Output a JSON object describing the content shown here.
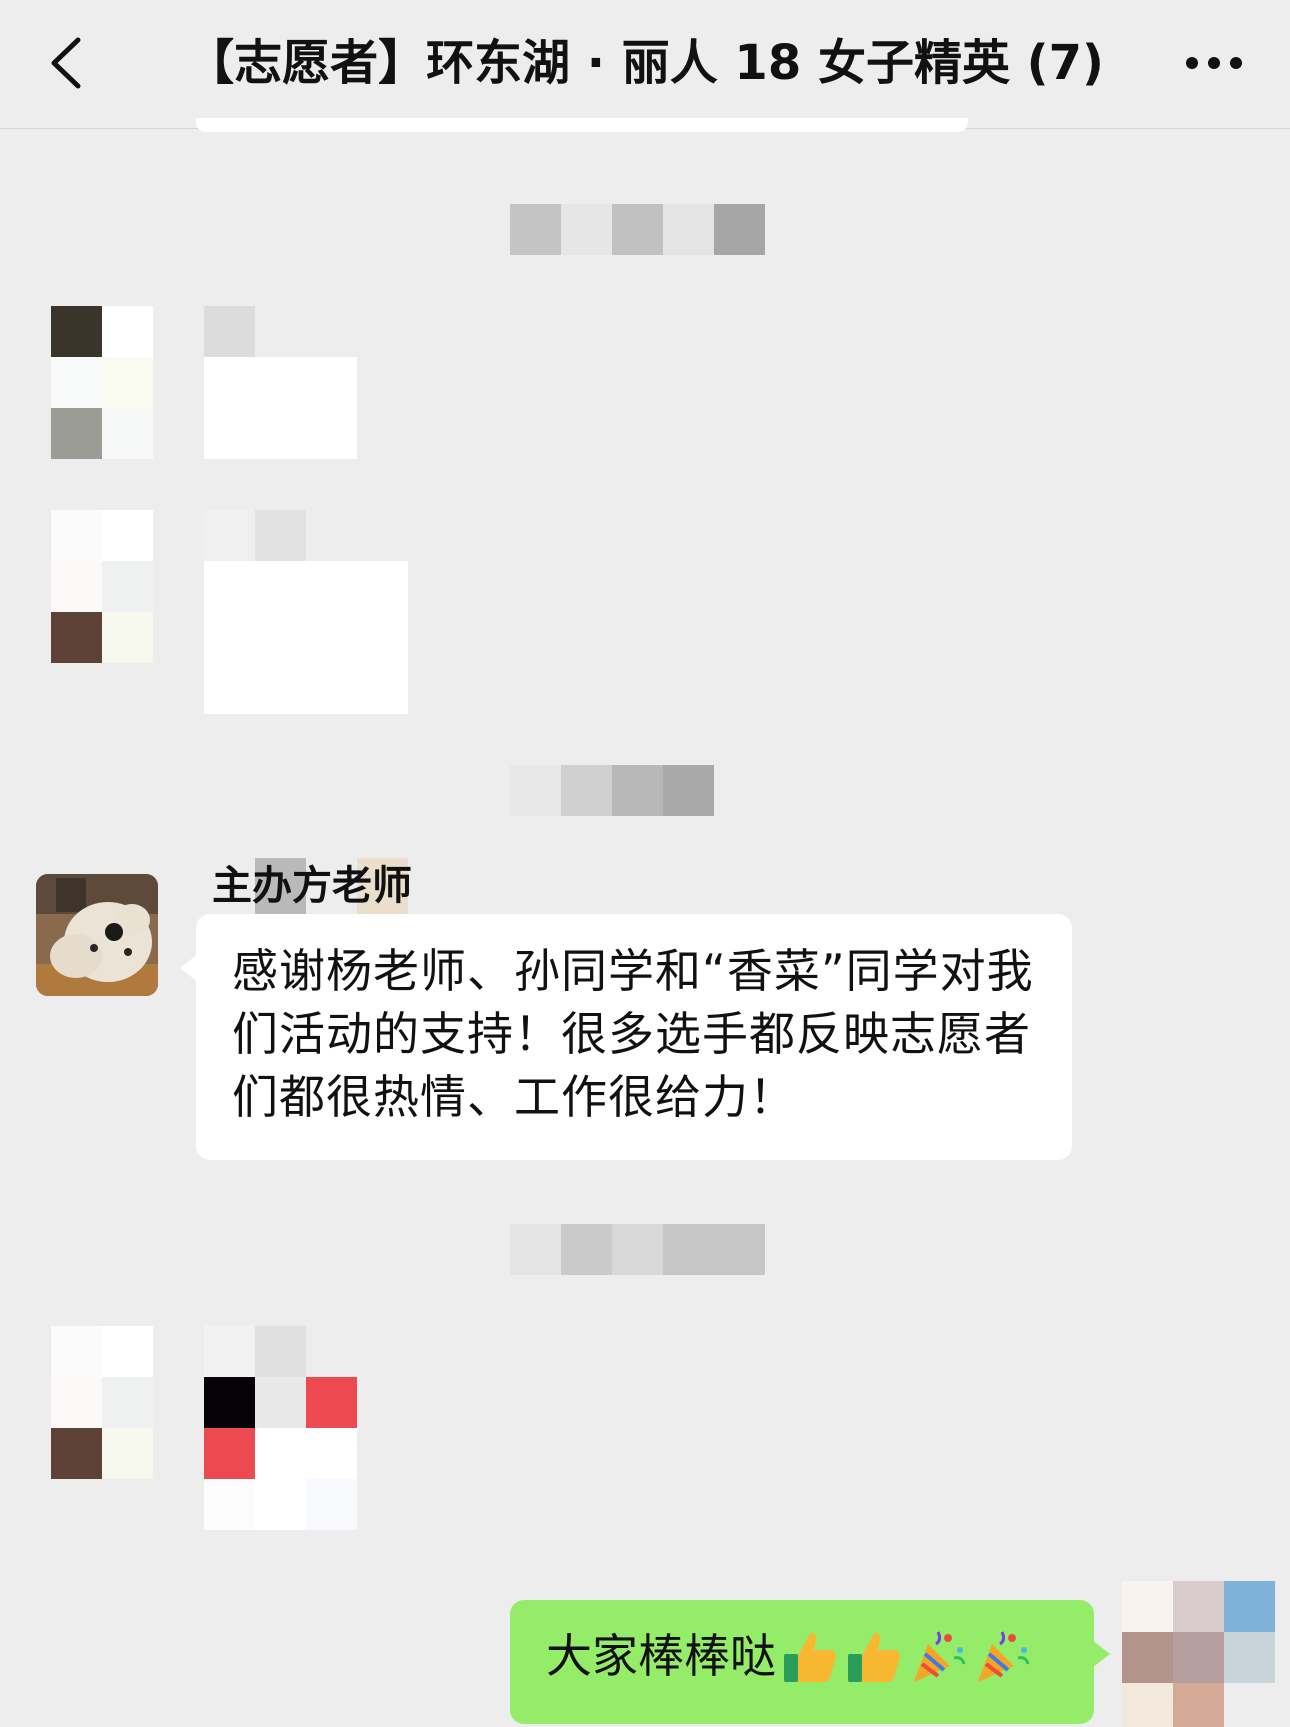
{
  "navbar": {
    "back_icon": "chevron-left-icon",
    "title": "【志愿者】环东湖 · 丽人 18 女子精英 (7)",
    "more_icon": "more-dots-icon"
  },
  "messages": {
    "organizer": {
      "sender": "主办方老师",
      "text": "感谢杨老师、孙同学和“香菜”同学对我们活动的支持！很多选手都反映志愿者们都很热情、工作很给力！",
      "avatar_icon": "dog-avatar-icon"
    },
    "self": {
      "text": "大家棒棒哒",
      "emojis": [
        "thumbs-up-icon",
        "thumbs-up-icon",
        "party-popper-icon",
        "party-popper-icon"
      ]
    }
  },
  "colors": {
    "background": "#ededed",
    "bubble_incoming": "#ffffff",
    "bubble_outgoing": "#95ec69",
    "text": "#111111"
  }
}
